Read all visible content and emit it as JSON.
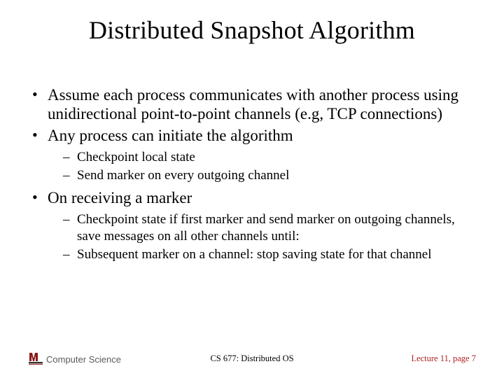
{
  "title": "Distributed Snapshot Algorithm",
  "bullets": {
    "b1": "Assume each process communicates with another process using unidirectional point-to-point channels (e.g, TCP connections)",
    "b2": "Any process can initiate the algorithm",
    "b2_sub1": "Checkpoint local state",
    "b2_sub2": "Send marker on every outgoing channel",
    "b3": "On receiving a marker",
    "b3_sub1": "Checkpoint state if first marker and send marker on outgoing channels, save messages on all other channels until:",
    "b3_sub2": "Subsequent marker on a channel: stop saving state for that channel"
  },
  "footer": {
    "left": "Computer Science",
    "center": "CS 677: Distributed OS",
    "right": "Lecture 11, page 7"
  },
  "logo_name": "umass-logo"
}
